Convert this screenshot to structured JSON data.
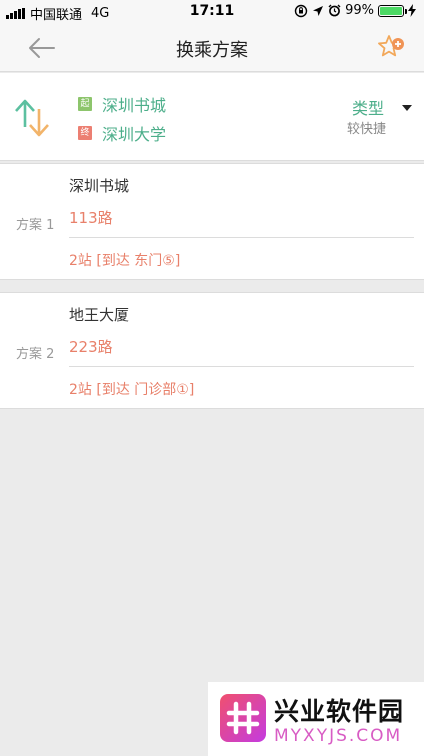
{
  "status_bar": {
    "carrier": "中国联通",
    "network": "4G",
    "time": "17:11",
    "battery": "99%",
    "battery_level": 0.99
  },
  "nav": {
    "title": "换乘方案"
  },
  "route": {
    "start_tag": "起",
    "start": "深圳书城",
    "end_tag": "终",
    "end": "深圳大学",
    "type_label": "类型",
    "type_value": "较快捷"
  },
  "plans": [
    {
      "label": "方案 1",
      "stop": "深圳书城",
      "line": "113路",
      "detail": "2站 [到达 东门⑤]"
    },
    {
      "label": "方案 2",
      "stop": "地王大厦",
      "line": "223路",
      "detail": "2站 [到达 门诊部①]"
    }
  ],
  "watermark": {
    "name": "兴业软件园",
    "url": "MYXYJS.COM"
  },
  "colors": {
    "accent_green": "#4cae8a",
    "accent_orange": "#e8806a",
    "tag_start": "#8dc56c",
    "tag_end": "#ec7f72"
  }
}
